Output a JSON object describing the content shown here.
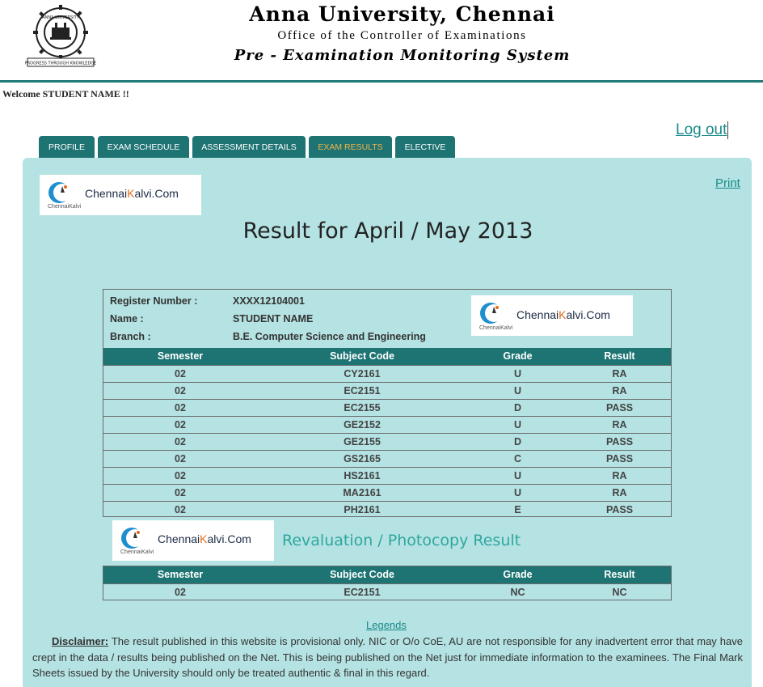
{
  "header": {
    "logo_text_top": "ANNA UNIVERSITY",
    "logo_text_bottom": "PROGRESS THROUGH KNOWLEDGE",
    "title": "Anna University, Chennai",
    "subtitle": "Office of the Controller of Examinations",
    "system": "Pre - Examination Monitoring System"
  },
  "welcome": "Welcome STUDENT NAME !!",
  "logout": "Log out",
  "tabs": [
    {
      "label": "PROFILE",
      "active": false
    },
    {
      "label": "EXAM SCHEDULE",
      "active": false
    },
    {
      "label": "ASSESSMENT DETAILS",
      "active": false
    },
    {
      "label": "EXAM RESULTS",
      "active": true
    },
    {
      "label": "ELECTIVE",
      "active": false
    }
  ],
  "print": "Print",
  "watermark": {
    "brand_pre": "Chennai",
    "brand_k": "K",
    "brand_post": "alvi.Com",
    "small": "ChennaiKalvi"
  },
  "result_title": "Result for April / May 2013",
  "student": {
    "register_label": "Register Number :",
    "register_value": "XXXX12104001",
    "name_label": "Name :",
    "name_value": "STUDENT NAME",
    "branch_label": "Branch :",
    "branch_value": "B.E. Computer Science and Engineering"
  },
  "results_table": {
    "headers": [
      "Semester",
      "Subject Code",
      "Grade",
      "Result"
    ],
    "rows": [
      [
        "02",
        "CY2161",
        "U",
        "RA"
      ],
      [
        "02",
        "EC2151",
        "U",
        "RA"
      ],
      [
        "02",
        "EC2155",
        "D",
        "PASS"
      ],
      [
        "02",
        "GE2152",
        "U",
        "RA"
      ],
      [
        "02",
        "GE2155",
        "D",
        "PASS"
      ],
      [
        "02",
        "GS2165",
        "C",
        "PASS"
      ],
      [
        "02",
        "HS2161",
        "U",
        "RA"
      ],
      [
        "02",
        "MA2161",
        "U",
        "RA"
      ],
      [
        "02",
        "PH2161",
        "E",
        "PASS"
      ]
    ]
  },
  "reval_title": "Revaluation / Photocopy Result",
  "reval_table": {
    "headers": [
      "Semester",
      "Subject Code",
      "Grade",
      "Result"
    ],
    "rows": [
      [
        "02",
        "EC2151",
        "NC",
        "NC"
      ]
    ]
  },
  "legends": "Legends",
  "disclaimer": {
    "heading": "Disclaimer:",
    "text": " The result published in this website is provisional only. NIC or O/o CoE, AU are not responsible for any inadvertent error that may have crept in the data / results being published on the Net. This is being published on the Net just for immediate information to the examinees. The Final Mark Sheets issued by the University should only be treated authentic & final in this regard."
  },
  "colors": {
    "teal_dark": "#1e7373",
    "panel_bg": "#b5e2e2",
    "link": "#1a8a8a",
    "active_tab": "#f1b34a"
  }
}
